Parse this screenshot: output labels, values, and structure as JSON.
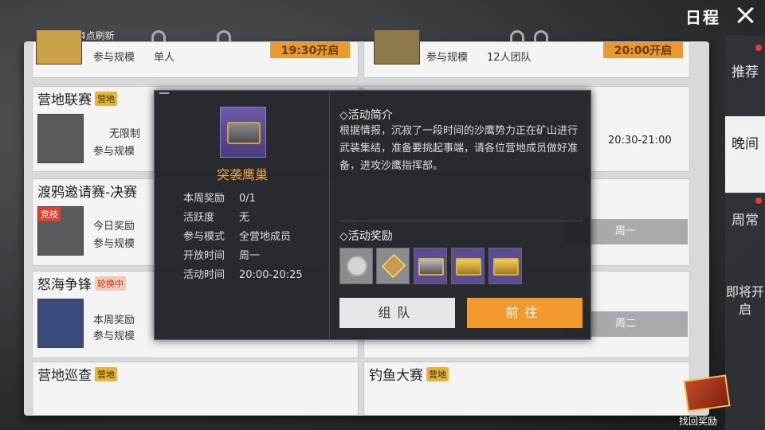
{
  "header": {
    "refresh_text": "每日凌晨4点刷新",
    "title": "日程",
    "close_icon": "close-icon"
  },
  "tabs": [
    {
      "label": "推荐",
      "active": false,
      "dot": true
    },
    {
      "label": "晚间",
      "active": true,
      "dot": false
    },
    {
      "label": "周常",
      "active": false,
      "dot": true
    },
    {
      "label": "即将开启",
      "active": false,
      "dot": false
    }
  ],
  "cards": {
    "top_left": {
      "scale_label": "参与规模",
      "scale_value": "单人",
      "time": "19:30开启"
    },
    "top_right": {
      "scale_label": "参与规模",
      "scale_value": "12人团队",
      "time": "20:00开启"
    },
    "camp_league": {
      "title": "营地联赛",
      "tag": "营地",
      "line1": "无限制",
      "line2": "参与规模",
      "time": "20:30-21:00"
    },
    "raven": {
      "title": "渡鸦邀请赛-决赛",
      "tag": "竞技",
      "line1": "今日奖励",
      "line2": "参与规模",
      "day": "周一"
    },
    "angry_sea": {
      "title": "怒海争锋",
      "tag": "轮换中",
      "line1": "本周奖励",
      "line2": "参与规模",
      "day": "周二"
    },
    "camp_patrol": {
      "title": "营地巡查",
      "tag": "营地"
    },
    "fishing": {
      "title": "钓鱼大赛",
      "tag": "营地"
    }
  },
  "popup": {
    "name": "突袭鹰巢",
    "info": [
      {
        "key": "本周奖励",
        "value": "0/1"
      },
      {
        "key": "活跃度",
        "value": "无"
      },
      {
        "key": "参与模式",
        "value": "全营地成员"
      },
      {
        "key": "开放时间",
        "value": "周一"
      },
      {
        "key": "活动时间",
        "value": "20:00-20:25"
      }
    ],
    "intro_title": "◇活动简介",
    "intro_text": "根据情报，沉寂了一段时间的沙鹰势力正在矿山进行武装集结，准备要挑起事端，请各位营地成员做好准备，进攻沙鹰指挥部。",
    "reward_title": "◇活动奖励",
    "rewards": [
      "silver-coin-icon",
      "camp-badge-icon",
      "purple-chest-icon",
      "gold-chest-icon",
      "gold-chest-icon"
    ],
    "team_button": "组队",
    "go_button": "前往"
  },
  "gift": {
    "label": "找回奖励"
  },
  "colors": {
    "accent_orange": "#f29a2e",
    "popup_bg": "#1e2228",
    "active_tab": "#f1f1f1"
  }
}
